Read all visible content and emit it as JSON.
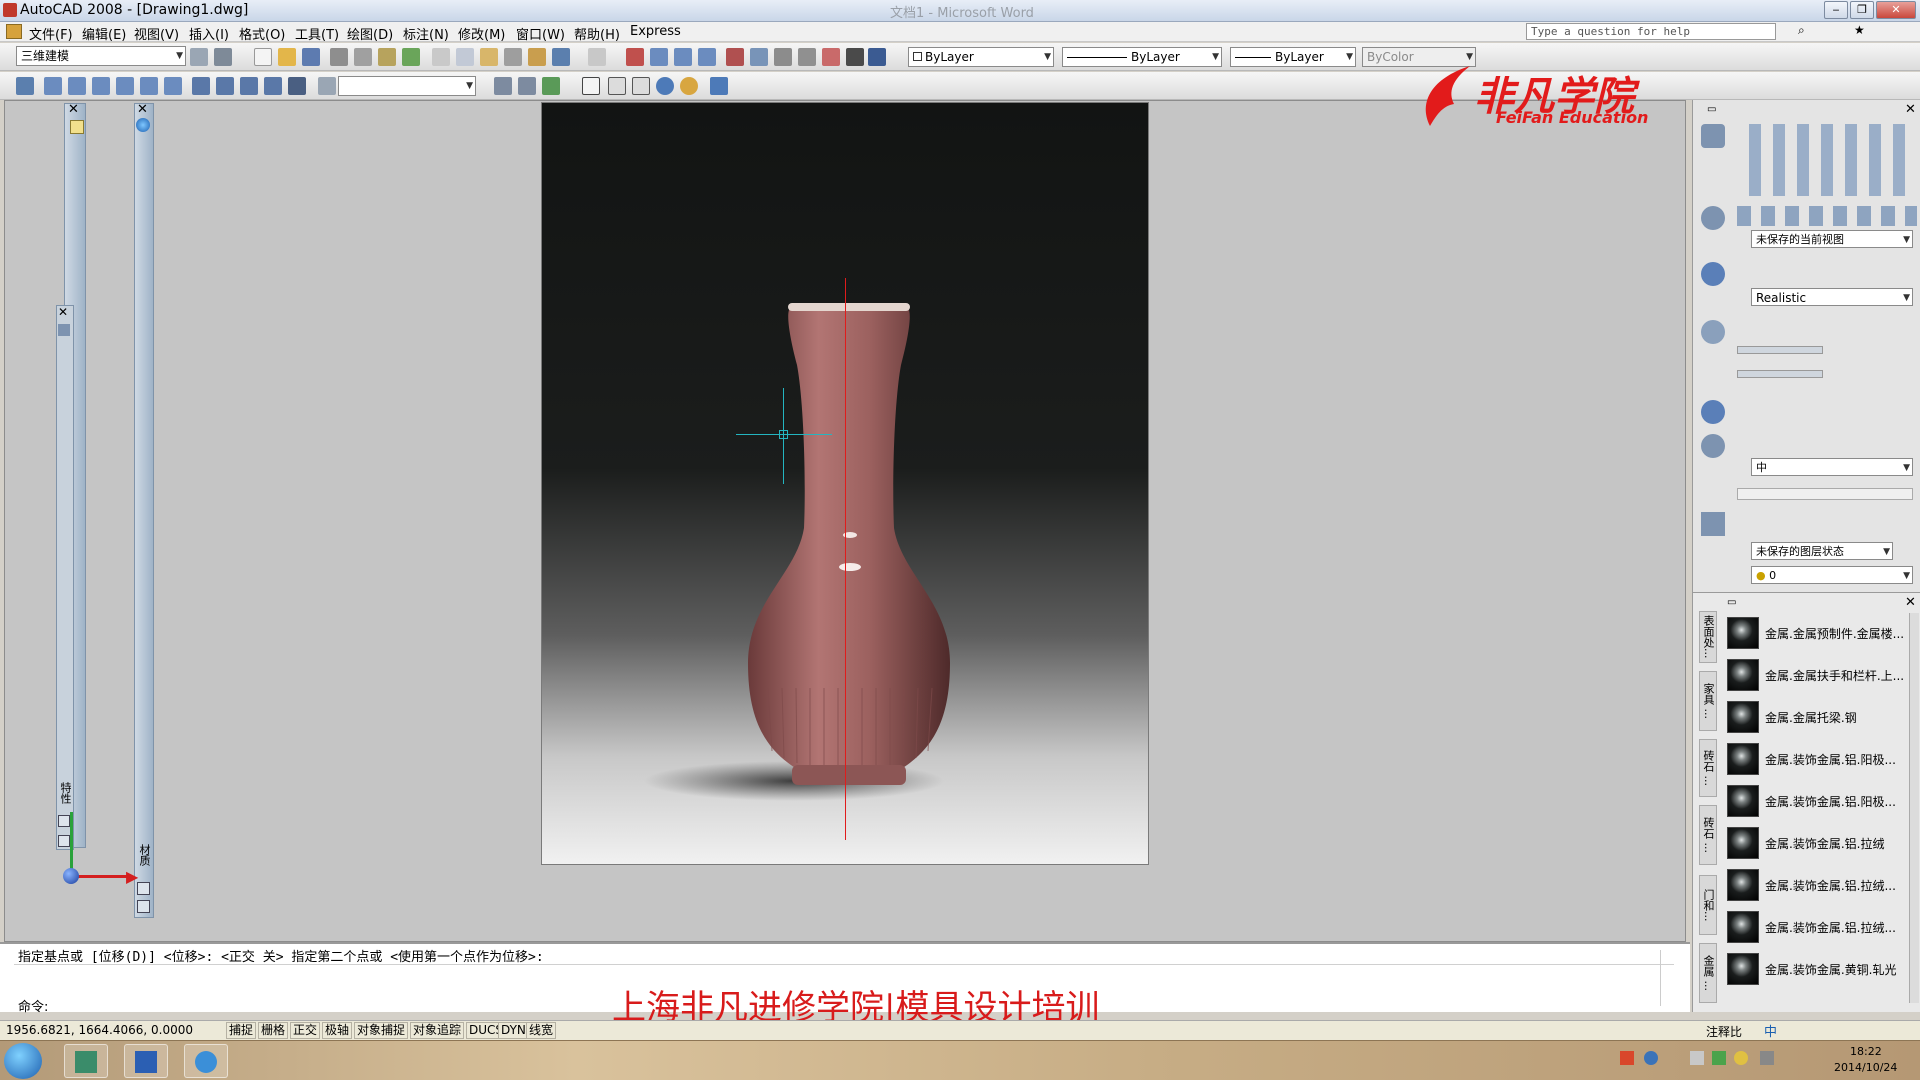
{
  "window": {
    "title": "AutoCAD 2008 - [Drawing1.dwg]",
    "ghost_title": "文档1 - Microsoft Word",
    "help_placeholder": "Type a question for help"
  },
  "menu": [
    "文件(F)",
    "编辑(E)",
    "视图(V)",
    "插入(I)",
    "格式(O)",
    "工具(T)",
    "绘图(D)",
    "标注(N)",
    "修改(M)",
    "窗口(W)",
    "帮助(H)",
    "Express"
  ],
  "workspace": "三维建模",
  "properties": {
    "color": "ByLayer",
    "linetype": "ByLayer",
    "lineweight": "ByLayer",
    "plotstyle": "ByColor"
  },
  "logo": {
    "cn": "非凡学院",
    "en": "FeiFan Education"
  },
  "right_panel": {
    "view_combo": "未保存的当前视图",
    "visual_style": "Realistic",
    "light_combo": "中",
    "layer_state": "未保存的图层状态",
    "layer": "0"
  },
  "materials": [
    "金属.金属预制件.金属楼...",
    "金属.金属扶手和栏杆.上...",
    "金属.金属托梁.钢",
    "金属.装饰金属.铝.阳极...",
    "金属.装饰金属.铝.阳极...",
    "金属.装饰金属.铝.拉绒",
    "金属.装饰金属.铝.拉绒...",
    "金属.装饰金属.铝.拉绒...",
    "金属.装饰金属.黄铜.轧光"
  ],
  "material_tabs": [
    "表面处...",
    "家具 ...",
    "砖石 ...",
    "砖石 ...",
    "门和...",
    "金属 ..."
  ],
  "command": {
    "history": "指定基点或 [位移(D)] <位移>:  <正交 关> 指定第二个点或 <使用第一个点作为位移>:",
    "prompt": "命令:",
    "watermark": "上海非凡进修学院|模具设计培训"
  },
  "status": {
    "coords": "1956.6821,  1664.4066,  0.0000",
    "buttons": [
      "捕捉",
      "栅格",
      "正交",
      "极轴",
      "对象捕捉",
      "对象追踪",
      "DUCS",
      "DYN",
      "线宽"
    ],
    "annotation": "注释比"
  },
  "left_palettes": {
    "props_label": "特性",
    "material_label": "材质"
  },
  "taskbar": {
    "time": "18:22",
    "date": "2014/10/24",
    "ime": "中"
  }
}
